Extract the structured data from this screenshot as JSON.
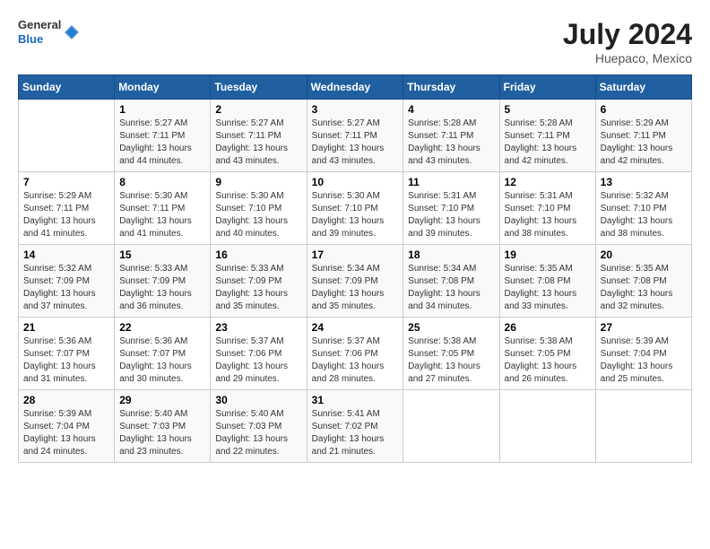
{
  "header": {
    "logo_line1": "General",
    "logo_line2": "Blue",
    "month_year": "July 2024",
    "location": "Huepaco, Mexico"
  },
  "days_of_week": [
    "Sunday",
    "Monday",
    "Tuesday",
    "Wednesday",
    "Thursday",
    "Friday",
    "Saturday"
  ],
  "weeks": [
    [
      {
        "num": "",
        "sunrise": "",
        "sunset": "",
        "daylight": ""
      },
      {
        "num": "1",
        "sunrise": "Sunrise: 5:27 AM",
        "sunset": "Sunset: 7:11 PM",
        "daylight": "Daylight: 13 hours and 44 minutes."
      },
      {
        "num": "2",
        "sunrise": "Sunrise: 5:27 AM",
        "sunset": "Sunset: 7:11 PM",
        "daylight": "Daylight: 13 hours and 43 minutes."
      },
      {
        "num": "3",
        "sunrise": "Sunrise: 5:27 AM",
        "sunset": "Sunset: 7:11 PM",
        "daylight": "Daylight: 13 hours and 43 minutes."
      },
      {
        "num": "4",
        "sunrise": "Sunrise: 5:28 AM",
        "sunset": "Sunset: 7:11 PM",
        "daylight": "Daylight: 13 hours and 43 minutes."
      },
      {
        "num": "5",
        "sunrise": "Sunrise: 5:28 AM",
        "sunset": "Sunset: 7:11 PM",
        "daylight": "Daylight: 13 hours and 42 minutes."
      },
      {
        "num": "6",
        "sunrise": "Sunrise: 5:29 AM",
        "sunset": "Sunset: 7:11 PM",
        "daylight": "Daylight: 13 hours and 42 minutes."
      }
    ],
    [
      {
        "num": "7",
        "sunrise": "Sunrise: 5:29 AM",
        "sunset": "Sunset: 7:11 PM",
        "daylight": "Daylight: 13 hours and 41 minutes."
      },
      {
        "num": "8",
        "sunrise": "Sunrise: 5:30 AM",
        "sunset": "Sunset: 7:11 PM",
        "daylight": "Daylight: 13 hours and 41 minutes."
      },
      {
        "num": "9",
        "sunrise": "Sunrise: 5:30 AM",
        "sunset": "Sunset: 7:10 PM",
        "daylight": "Daylight: 13 hours and 40 minutes."
      },
      {
        "num": "10",
        "sunrise": "Sunrise: 5:30 AM",
        "sunset": "Sunset: 7:10 PM",
        "daylight": "Daylight: 13 hours and 39 minutes."
      },
      {
        "num": "11",
        "sunrise": "Sunrise: 5:31 AM",
        "sunset": "Sunset: 7:10 PM",
        "daylight": "Daylight: 13 hours and 39 minutes."
      },
      {
        "num": "12",
        "sunrise": "Sunrise: 5:31 AM",
        "sunset": "Sunset: 7:10 PM",
        "daylight": "Daylight: 13 hours and 38 minutes."
      },
      {
        "num": "13",
        "sunrise": "Sunrise: 5:32 AM",
        "sunset": "Sunset: 7:10 PM",
        "daylight": "Daylight: 13 hours and 38 minutes."
      }
    ],
    [
      {
        "num": "14",
        "sunrise": "Sunrise: 5:32 AM",
        "sunset": "Sunset: 7:09 PM",
        "daylight": "Daylight: 13 hours and 37 minutes."
      },
      {
        "num": "15",
        "sunrise": "Sunrise: 5:33 AM",
        "sunset": "Sunset: 7:09 PM",
        "daylight": "Daylight: 13 hours and 36 minutes."
      },
      {
        "num": "16",
        "sunrise": "Sunrise: 5:33 AM",
        "sunset": "Sunset: 7:09 PM",
        "daylight": "Daylight: 13 hours and 35 minutes."
      },
      {
        "num": "17",
        "sunrise": "Sunrise: 5:34 AM",
        "sunset": "Sunset: 7:09 PM",
        "daylight": "Daylight: 13 hours and 35 minutes."
      },
      {
        "num": "18",
        "sunrise": "Sunrise: 5:34 AM",
        "sunset": "Sunset: 7:08 PM",
        "daylight": "Daylight: 13 hours and 34 minutes."
      },
      {
        "num": "19",
        "sunrise": "Sunrise: 5:35 AM",
        "sunset": "Sunset: 7:08 PM",
        "daylight": "Daylight: 13 hours and 33 minutes."
      },
      {
        "num": "20",
        "sunrise": "Sunrise: 5:35 AM",
        "sunset": "Sunset: 7:08 PM",
        "daylight": "Daylight: 13 hours and 32 minutes."
      }
    ],
    [
      {
        "num": "21",
        "sunrise": "Sunrise: 5:36 AM",
        "sunset": "Sunset: 7:07 PM",
        "daylight": "Daylight: 13 hours and 31 minutes."
      },
      {
        "num": "22",
        "sunrise": "Sunrise: 5:36 AM",
        "sunset": "Sunset: 7:07 PM",
        "daylight": "Daylight: 13 hours and 30 minutes."
      },
      {
        "num": "23",
        "sunrise": "Sunrise: 5:37 AM",
        "sunset": "Sunset: 7:06 PM",
        "daylight": "Daylight: 13 hours and 29 minutes."
      },
      {
        "num": "24",
        "sunrise": "Sunrise: 5:37 AM",
        "sunset": "Sunset: 7:06 PM",
        "daylight": "Daylight: 13 hours and 28 minutes."
      },
      {
        "num": "25",
        "sunrise": "Sunrise: 5:38 AM",
        "sunset": "Sunset: 7:05 PM",
        "daylight": "Daylight: 13 hours and 27 minutes."
      },
      {
        "num": "26",
        "sunrise": "Sunrise: 5:38 AM",
        "sunset": "Sunset: 7:05 PM",
        "daylight": "Daylight: 13 hours and 26 minutes."
      },
      {
        "num": "27",
        "sunrise": "Sunrise: 5:39 AM",
        "sunset": "Sunset: 7:04 PM",
        "daylight": "Daylight: 13 hours and 25 minutes."
      }
    ],
    [
      {
        "num": "28",
        "sunrise": "Sunrise: 5:39 AM",
        "sunset": "Sunset: 7:04 PM",
        "daylight": "Daylight: 13 hours and 24 minutes."
      },
      {
        "num": "29",
        "sunrise": "Sunrise: 5:40 AM",
        "sunset": "Sunset: 7:03 PM",
        "daylight": "Daylight: 13 hours and 23 minutes."
      },
      {
        "num": "30",
        "sunrise": "Sunrise: 5:40 AM",
        "sunset": "Sunset: 7:03 PM",
        "daylight": "Daylight: 13 hours and 22 minutes."
      },
      {
        "num": "31",
        "sunrise": "Sunrise: 5:41 AM",
        "sunset": "Sunset: 7:02 PM",
        "daylight": "Daylight: 13 hours and 21 minutes."
      },
      {
        "num": "",
        "sunrise": "",
        "sunset": "",
        "daylight": ""
      },
      {
        "num": "",
        "sunrise": "",
        "sunset": "",
        "daylight": ""
      },
      {
        "num": "",
        "sunrise": "",
        "sunset": "",
        "daylight": ""
      }
    ]
  ]
}
